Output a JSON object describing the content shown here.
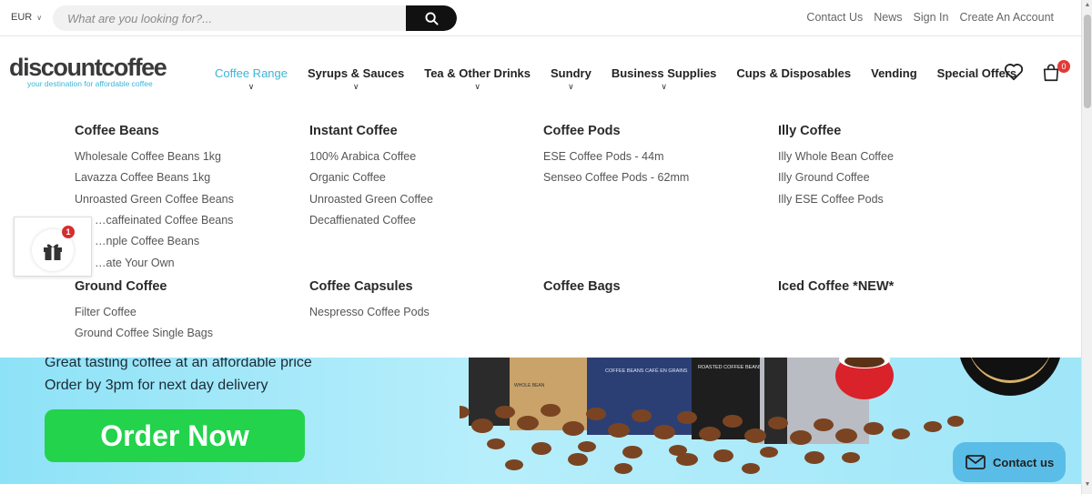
{
  "topbar": {
    "currency": "EUR",
    "search_placeholder": "What are you looking for?...",
    "links": [
      "Contact Us",
      "News",
      "Sign In",
      "Create An Account"
    ]
  },
  "logo": {
    "name": "discountcoffee",
    "tagline": "your destination for affordable coffee"
  },
  "nav": [
    "Coffee Range",
    "Syrups & Sauces",
    "Tea & Other Drinks",
    "Sundry",
    "Business Supplies",
    "Cups & Disposables",
    "Vending",
    "Special Offers"
  ],
  "cart_count": "0",
  "mega": {
    "coffee_beans": {
      "title": "Coffee Beans",
      "items": [
        "Wholesale Coffee Beans 1kg",
        "Lavazza Coffee Beans 1kg",
        "Unroasted Green Coffee Beans",
        "…caffeinated Coffee Beans",
        "…nple Coffee Beans",
        "…ate Your Own"
      ]
    },
    "instant_coffee": {
      "title": "Instant Coffee",
      "items": [
        "100% Arabica Coffee",
        "Organic Coffee",
        "Unroasted Green Coffee",
        "Decaffienated Coffee"
      ]
    },
    "coffee_pods": {
      "title": "Coffee Pods",
      "items": [
        "ESE Coffee Pods - 44m",
        "Senseo Coffee Pods - 62mm"
      ]
    },
    "illy_coffee": {
      "title": "Illy Coffee",
      "items": [
        "Illy Whole Bean Coffee",
        "Illy Ground Coffee",
        "Illy ESE Coffee Pods"
      ]
    },
    "ground_coffee": {
      "title": "Ground Coffee",
      "items": [
        "Filter Coffee",
        "Ground Coffee Single Bags"
      ]
    },
    "coffee_capsules": {
      "title": "Coffee Capsules",
      "items": [
        "Nespresso Coffee Pods"
      ]
    },
    "coffee_bags": {
      "title": "Coffee Bags"
    },
    "iced_coffee": {
      "title": "Iced Coffee *NEW*"
    }
  },
  "hero": {
    "line1": "Great tasting coffee at an affordable price",
    "line2": "Order by 3pm for next day delivery",
    "button": "Order Now",
    "bag1_text": "COFFEE BEANS CAFÉ EN GRAINS",
    "bag2_text": "ROASTED COFFEE BEANS CAFÉ TORRÉFIÉ EN GRAINS",
    "bag_label": "WHOLE BEAN"
  },
  "gift_badge": "1",
  "contact_widget": "Contact us",
  "colors": {
    "accent": "#3cb4d6",
    "order_button": "#22d34b",
    "badge_red": "#e53935"
  }
}
